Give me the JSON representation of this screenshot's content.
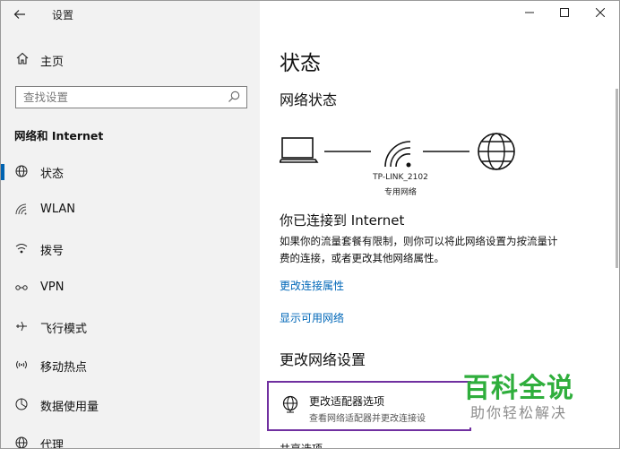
{
  "app_title": "设置",
  "home": {
    "label": "主页"
  },
  "search": {
    "placeholder": "查找设置"
  },
  "section_title": "网络和 Internet",
  "nav": [
    {
      "label": "状态",
      "icon": "home-globe-icon",
      "selected": true
    },
    {
      "label": "WLAN",
      "icon": "wifi-icon",
      "selected": false
    },
    {
      "label": "拨号",
      "icon": "dialup-icon",
      "selected": false
    },
    {
      "label": "VPN",
      "icon": "vpn-icon",
      "selected": false
    },
    {
      "label": "飞行模式",
      "icon": "airplane-icon",
      "selected": false
    },
    {
      "label": "移动热点",
      "icon": "hotspot-icon",
      "selected": false
    },
    {
      "label": "数据使用量",
      "icon": "data-usage-icon",
      "selected": false
    },
    {
      "label": "代理",
      "icon": "proxy-globe-icon",
      "selected": false
    }
  ],
  "main": {
    "page_title": "状态",
    "network_status_heading": "网络状态",
    "network_name": "TP-LINK_2102",
    "network_type": "专用网络",
    "connected_heading": "你已连接到 Internet",
    "description_line1": "如果你的流量套餐有限制，则你可以将此网络设置为按流量计",
    "description_line2": "费的连接，或者更改其他网络属性。",
    "link_change_properties": "更改连接属性",
    "link_show_networks": "显示可用网络",
    "change_settings_heading": "更改网络设置",
    "adapter_option_title": "更改适配器选项",
    "adapter_option_desc": "查看网络适配器并更改连接设",
    "partial_next_item": "共享选项"
  },
  "watermark": {
    "title": "百科全说",
    "subtitle": "助你轻松解决"
  },
  "colors": {
    "accent": "#0067b8",
    "selection_bar": "#0063b1",
    "highlight_border": "#7030a0",
    "watermark_green": "#2fae3c"
  }
}
